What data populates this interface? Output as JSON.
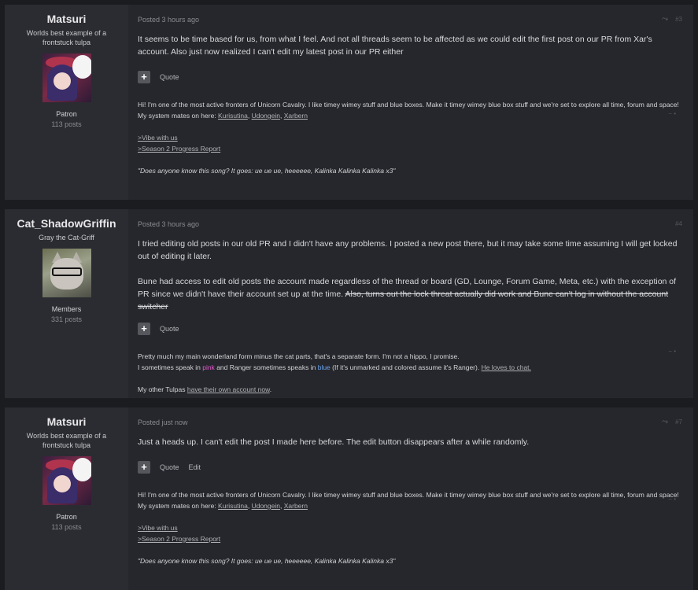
{
  "posts": [
    {
      "author": "Matsuri",
      "title": "Worlds best example of a frontstuck tulpa",
      "group": "Patron",
      "post_count": "113 posts",
      "posted": "Posted 3 hours ago",
      "post_number": "#3",
      "body": [
        "It seems to be time based for us, from what I feel. And not all threads seem to be affected as we could edit the first post on our PR from Xar's account. Also just now realized I can't edit my latest post in our PR either"
      ],
      "actions": [
        "Quote"
      ],
      "signature": {
        "intro": "Hi! I'm one of the most active fronters of Unicorn Cavalry. I like timey wimey stuff and blue boxes. Make it timey wimey blue box stuff and we're set to explore all time, forum and space!",
        "mates_label": "My system mates on here:",
        "mates": [
          "Kurisutina",
          "Udongein",
          "Xarbern"
        ],
        "link1": ">Vibe with us",
        "link2": ">Season 2 Progress Report",
        "quote": "\"Does anyone know this song? It goes: ue ue ue, heeeeee, Kalinka Kalinka Kalinka x3\""
      }
    },
    {
      "author": "Cat_ShadowGriffin",
      "title": "Gray the Cat-Griff",
      "group": "Members",
      "post_count": "331 posts",
      "posted": "Posted 3 hours ago",
      "post_number": "#4",
      "body": [
        "I tried editing old posts in our old PR and I didn't have any problems. I posted a new post there, but it may take some time assuming I will get locked out of editing it later.",
        "Bune had access to edit old posts the account made regardless of the thread or board (GD, Lounge, Forum Game, Meta, etc.) with the exception of PR since we didn't have their account set up at the time."
      ],
      "body_strike": "Also, turns out the lock threat actually did work and Bune can't log in without the account switcher",
      "actions": [
        "Quote"
      ],
      "signature": {
        "line1": "Pretty much my main wonderland form minus the cat parts, that's a separate form. I'm not a hippo, I promise.",
        "line2_a": "I sometimes speak in",
        "pink": "pink",
        "line2_b": "and Ranger sometimes speaks in",
        "blue": "blue",
        "line2_c": "(If it's unmarked and colored assume it's Ranger).",
        "line2_link": "He loves to chat.",
        "line3_a": "My other Tulpas",
        "line3_link": "have their own account now",
        "line3_b": "."
      }
    },
    {
      "author": "Matsuri",
      "title": "Worlds best example of a frontstuck tulpa",
      "group": "Patron",
      "post_count": "113 posts",
      "posted": "Posted just now",
      "post_number": "#7",
      "body": [
        "Just a heads up. I can't edit the post I made here before. The edit button disappears after a while randomly."
      ],
      "actions": [
        "Quote",
        "Edit"
      ],
      "signature": {
        "intro": "Hi! I'm one of the most active fronters of Unicorn Cavalry. I like timey wimey stuff and blue boxes. Make it timey wimey blue box stuff and we're set to explore all time, forum and space!",
        "mates_label": "My system mates on here:",
        "mates": [
          "Kurisutina",
          "Udongein",
          "Xarbern"
        ],
        "link1": ">Vibe with us",
        "link2": ">Season 2 Progress Report",
        "quote": "\"Does anyone know this song? It goes: ue ue ue, heeeeee, Kalinka Kalinka Kalinka x3\""
      }
    }
  ],
  "icons": {
    "share": "share-icon",
    "add": "plus-icon",
    "signature_toggle": "collapse-icon"
  },
  "colors": {
    "background": "#1b1c20",
    "post": "#26272c",
    "author_panel": "#2b2c31",
    "pink": "#e45ad0",
    "blue": "#6aa3ee"
  }
}
